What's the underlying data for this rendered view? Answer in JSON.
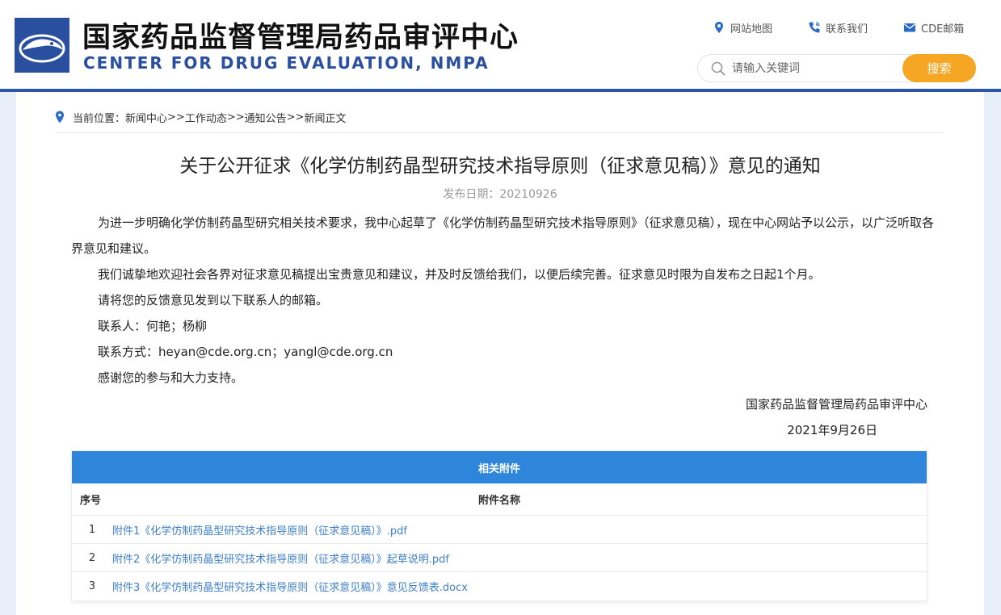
{
  "header": {
    "title_cn": "国家药品监督管理局药品审评中心",
    "title_en": "CENTER FOR DRUG EVALUATION, NMPA",
    "links": [
      {
        "label": "网站地图",
        "icon": "map-pin-icon"
      },
      {
        "label": "联系我们",
        "icon": "phone-icon"
      },
      {
        "label": "CDE邮箱",
        "icon": "mail-icon"
      }
    ],
    "search": {
      "placeholder": "请输入关键词",
      "button": "搜索"
    },
    "accent_color": "#2a55a8",
    "search_button_color": "#f5a623"
  },
  "breadcrumb": {
    "prefix": "当前位置：",
    "items": [
      "新闻中心",
      "工作动态",
      "通知公告",
      "新闻正文"
    ],
    "separator": ">>"
  },
  "article": {
    "title": "关于公开征求《化学仿制药晶型研究技术指导原则（征求意见稿）》意见的通知",
    "date": "发布日期：20210926",
    "paragraphs": [
      "为进一步明确化学仿制药晶型研究相关技术要求，我中心起草了《化学仿制药晶型研究技术指导原则》（征求意见稿），现在中心网站予以公示，以广泛听取各界意见和建议。",
      "我们诚挚地欢迎社会各界对征求意见稿提出宝贵意见和建议，并及时反馈给我们，以便后续完善。征求意见时限为自发布之日起1个月。",
      "请将您的反馈意见发到以下联系人的邮箱。",
      "联系人：何艳；杨柳",
      "联系方式：heyan@cde.org.cn；yangl@cde.org.cn",
      "感谢您的参与和大力支持。"
    ],
    "signature_org": "国家药品监督管理局药品审评中心",
    "signature_date": "2021年9月26日"
  },
  "attachments": {
    "heading": "相关附件",
    "col_no": "序号",
    "col_name": "附件名称",
    "header_color": "#2d86d9",
    "rows": [
      {
        "no": "1",
        "name": "附件1《化学仿制药晶型研究技术指导原则（征求意见稿）》.pdf"
      },
      {
        "no": "2",
        "name": "附件2《化学仿制药晶型研究技术指导原则（征求意见稿）》起草说明.pdf"
      },
      {
        "no": "3",
        "name": "附件3《化学仿制药晶型研究技术指导原则（征求意见稿）》意见反馈表.docx"
      }
    ]
  }
}
